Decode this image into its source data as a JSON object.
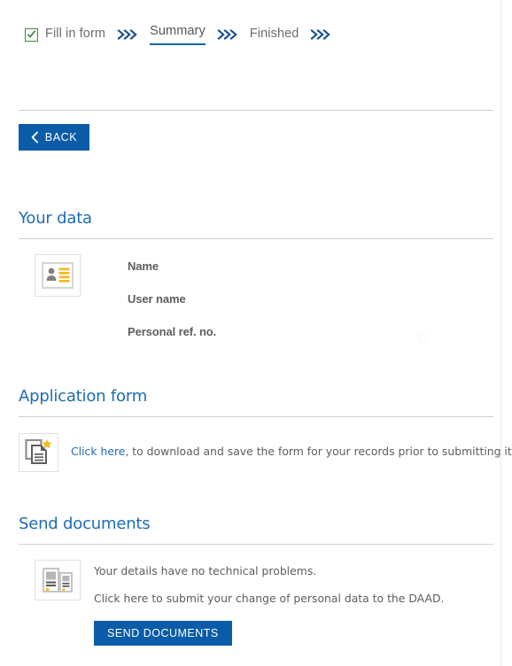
{
  "stepper": {
    "steps": [
      {
        "label": "Fill in form",
        "state": "completed",
        "icon": "checkbox-checked-icon"
      },
      {
        "label": "Summary",
        "state": "current",
        "icon": ""
      },
      {
        "label": "Finished",
        "state": "upcoming",
        "icon": ""
      }
    ],
    "separator_icon": "triple-chevron-right-icon"
  },
  "toolbar": {
    "back_label": "BACK",
    "back_icon": "chevron-left-icon"
  },
  "sections": {
    "your_data": {
      "title": "Your data",
      "icon": "id-card-icon",
      "fields": [
        {
          "label": "Name",
          "value": ""
        },
        {
          "label": "User name",
          "value": ""
        },
        {
          "label": "Personal ref. no.",
          "value": ""
        }
      ],
      "spinner_icon": "loading-spinner-icon"
    },
    "application_form": {
      "title": "Application form",
      "icon": "document-copy-star-icon",
      "link_label": "Click here",
      "text": ", to download and save the form for your records prior to submitting it."
    },
    "send_documents": {
      "title": "Send documents",
      "icon": "two-documents-icon",
      "line1": "Your details have no technical problems.",
      "line2": "Click here to submit your change of personal data to the DAAD.",
      "button_label": "SEND DOCUMENTS"
    }
  },
  "colors": {
    "brand_blue": "#0a5ca8",
    "heading_blue": "#1c6cb5",
    "chevron_blue": "#114c8e",
    "check_green": "#3f8a3f",
    "accent_yellow": "#f5b921",
    "text_gray": "#5d5d5d",
    "rule_gray": "#cfcfcf"
  }
}
